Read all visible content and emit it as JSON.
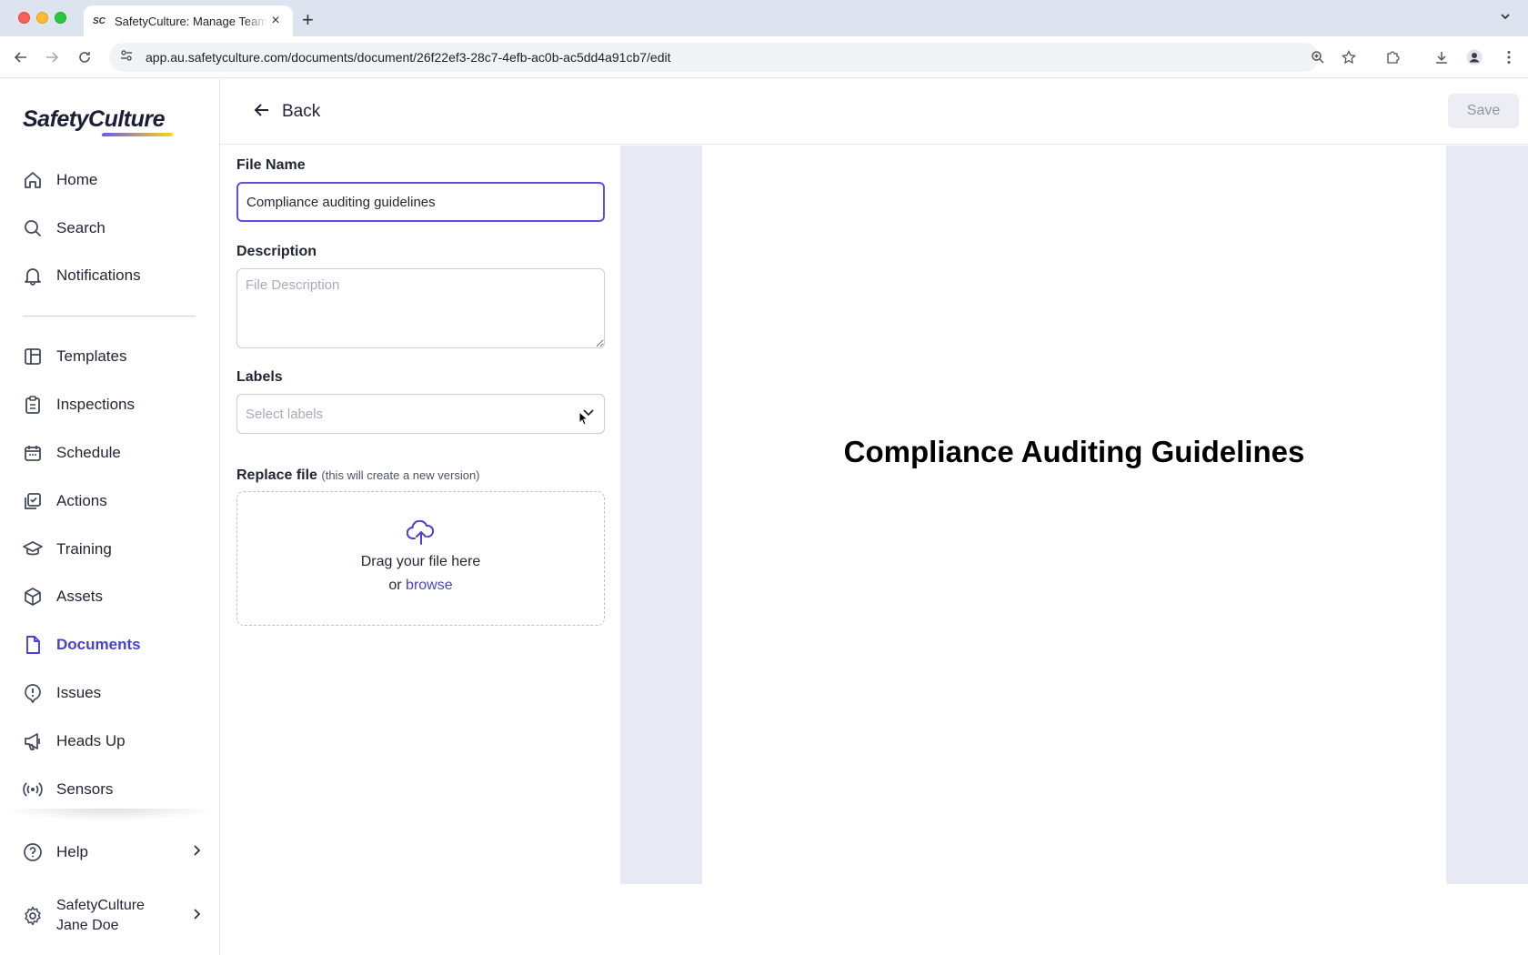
{
  "browser": {
    "tab_title": "SafetyCulture: Manage Teams",
    "tab_favicon": "SC",
    "url": "app.au.safetyculture.com/documents/document/26f22ef3-28c7-4efb-ac0b-ac5dd4a91cb7/edit"
  },
  "sidebar": {
    "logo": "SafetyCulture",
    "items": [
      {
        "label": "Home",
        "icon": "home-icon"
      },
      {
        "label": "Search",
        "icon": "search-icon"
      },
      {
        "label": "Notifications",
        "icon": "bell-icon"
      },
      {
        "label": "Templates",
        "icon": "template-icon"
      },
      {
        "label": "Inspections",
        "icon": "clipboard-icon"
      },
      {
        "label": "Schedule",
        "icon": "calendar-icon"
      },
      {
        "label": "Actions",
        "icon": "check-square-icon"
      },
      {
        "label": "Training",
        "icon": "graduation-cap-icon"
      },
      {
        "label": "Assets",
        "icon": "cube-icon"
      },
      {
        "label": "Documents",
        "icon": "document-icon",
        "active": true
      },
      {
        "label": "Issues",
        "icon": "alert-bubble-icon"
      },
      {
        "label": "Heads Up",
        "icon": "megaphone-icon"
      },
      {
        "label": "Sensors",
        "icon": "sensor-icon"
      }
    ],
    "help_label": "Help",
    "user_org": "SafetyCulture",
    "user_name": "Jane Doe"
  },
  "header": {
    "back_label": "Back",
    "save_label": "Save"
  },
  "form": {
    "file_name_label": "File Name",
    "file_name_value": "Compliance auditing guidelines",
    "description_label": "Description",
    "description_placeholder": "File Description",
    "labels_label": "Labels",
    "labels_placeholder": "Select labels",
    "replace_label": "Replace file",
    "replace_sub": "(this will create a new version)",
    "drop_text": "Drag your file here",
    "drop_or": "or",
    "drop_browse": "browse"
  },
  "preview": {
    "title": "Compliance Auditing Guidelines"
  },
  "colors": {
    "accent": "#4740d4",
    "input_focus": "#5b52e0",
    "preview_bg": "#e7eaf4"
  }
}
